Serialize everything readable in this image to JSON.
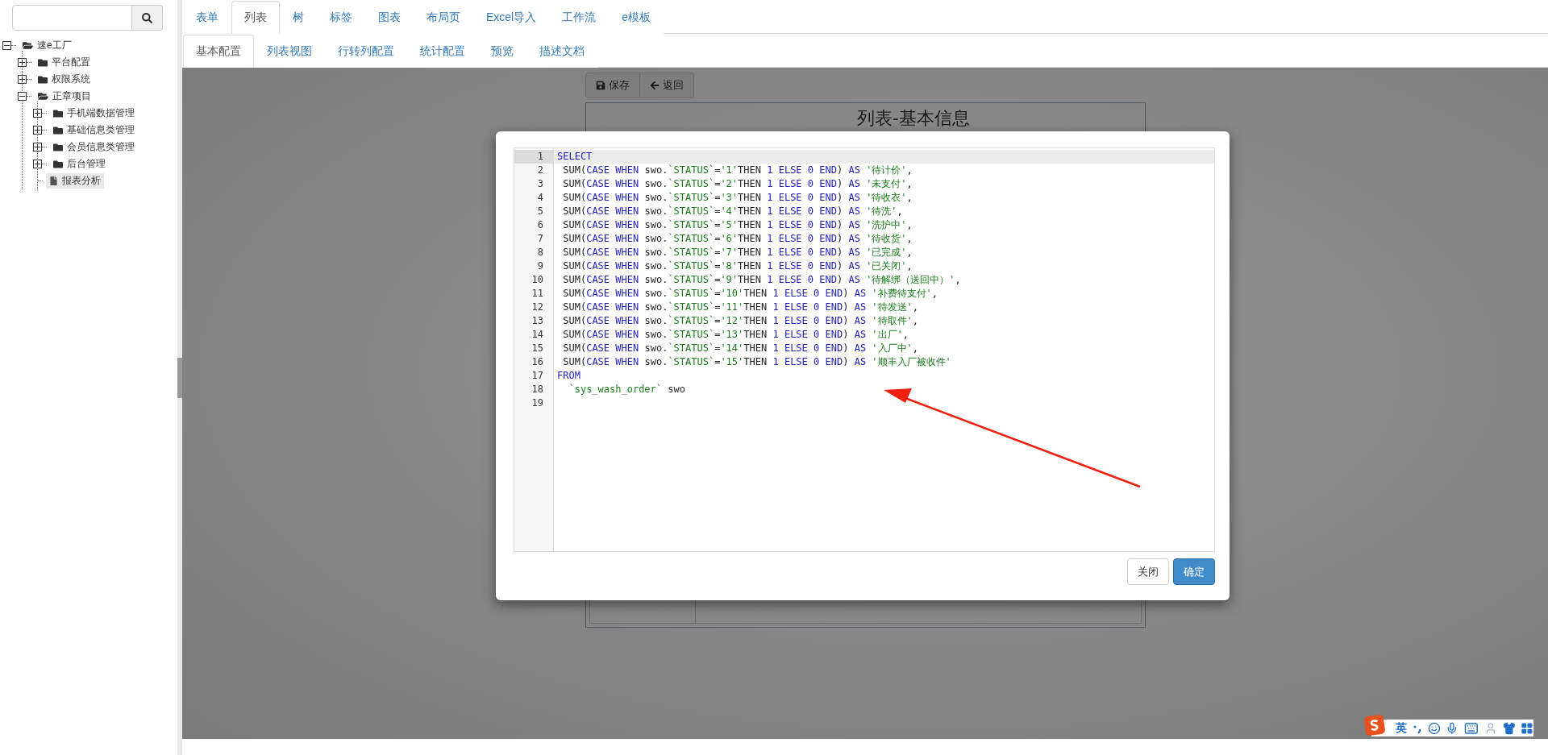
{
  "sidebar": {
    "tree": [
      {
        "label": "速e工厂",
        "kind": "folder",
        "expanded": true,
        "selected": false,
        "children": [
          {
            "label": "平台配置",
            "kind": "folder",
            "expanded": false,
            "selected": false
          },
          {
            "label": "权限系统",
            "kind": "folder",
            "expanded": false,
            "selected": false
          },
          {
            "label": "正章项目",
            "kind": "folder",
            "expanded": true,
            "selected": false,
            "children": [
              {
                "label": "手机端数据管理",
                "kind": "folder",
                "expanded": false,
                "selected": false
              },
              {
                "label": "基础信息类管理",
                "kind": "folder",
                "expanded": false,
                "selected": false
              },
              {
                "label": "会员信息类管理",
                "kind": "folder",
                "expanded": false,
                "selected": false
              },
              {
                "label": "后台管理",
                "kind": "folder",
                "expanded": false,
                "selected": false
              },
              {
                "label": "报表分析",
                "kind": "file",
                "selected": true
              }
            ]
          }
        ]
      }
    ]
  },
  "tabs": [
    {
      "label": "表单",
      "selected": false
    },
    {
      "label": "列表",
      "selected": true
    },
    {
      "label": "树",
      "selected": false
    },
    {
      "label": "标签",
      "selected": false
    },
    {
      "label": "图表",
      "selected": false
    },
    {
      "label": "布局页",
      "selected": false
    },
    {
      "label": "Excel导入",
      "selected": false
    },
    {
      "label": "工作流",
      "selected": false
    },
    {
      "label": "e模板",
      "selected": false
    }
  ],
  "subtabs": [
    {
      "label": "基本配置",
      "selected": true
    },
    {
      "label": "列表视图",
      "selected": false
    },
    {
      "label": "行转列配置",
      "selected": false
    },
    {
      "label": "统计配置",
      "selected": false
    },
    {
      "label": "预览",
      "selected": false
    },
    {
      "label": "描述文档",
      "selected": false
    }
  ],
  "background_form": {
    "buttons": [
      {
        "label": "保存",
        "kind": "save"
      },
      {
        "label": "返回",
        "kind": "back"
      }
    ],
    "title": "列表-基本信息"
  },
  "dialog": {
    "editor": {
      "lines": [
        {
          "number": "1",
          "text": "SELECT",
          "active": true
        },
        {
          "number": "2",
          "text": " SUM(CASE WHEN swo.`STATUS`='1'THEN 1 ELSE 0 END) AS '待计价',",
          "active": false
        },
        {
          "number": "3",
          "text": " SUM(CASE WHEN swo.`STATUS`='2'THEN 1 ELSE 0 END) AS '未支付',",
          "active": false
        },
        {
          "number": "4",
          "text": " SUM(CASE WHEN swo.`STATUS`='3'THEN 1 ELSE 0 END) AS '待收衣',",
          "active": false
        },
        {
          "number": "5",
          "text": " SUM(CASE WHEN swo.`STATUS`='4'THEN 1 ELSE 0 END) AS '待洗',",
          "active": false
        },
        {
          "number": "6",
          "text": " SUM(CASE WHEN swo.`STATUS`='5'THEN 1 ELSE 0 END) AS '洗护中',",
          "active": false
        },
        {
          "number": "7",
          "text": " SUM(CASE WHEN swo.`STATUS`='6'THEN 1 ELSE 0 END) AS '待收货',",
          "active": false
        },
        {
          "number": "8",
          "text": " SUM(CASE WHEN swo.`STATUS`='7'THEN 1 ELSE 0 END) AS '已完成',",
          "active": false
        },
        {
          "number": "9",
          "text": " SUM(CASE WHEN swo.`STATUS`='8'THEN 1 ELSE 0 END) AS '已关闭',",
          "active": false
        },
        {
          "number": "10",
          "text": " SUM(CASE WHEN swo.`STATUS`='9'THEN 1 ELSE 0 END) AS '待解绑（送回中）',",
          "active": false
        },
        {
          "number": "11",
          "text": " SUM(CASE WHEN swo.`STATUS`='10'THEN 1 ELSE 0 END) AS '补费待支付',",
          "active": false
        },
        {
          "number": "12",
          "text": " SUM(CASE WHEN swo.`STATUS`='11'THEN 1 ELSE 0 END) AS '待发送',",
          "active": false
        },
        {
          "number": "13",
          "text": " SUM(CASE WHEN swo.`STATUS`='12'THEN 1 ELSE 0 END) AS '待取件',",
          "active": false
        },
        {
          "number": "14",
          "text": " SUM(CASE WHEN swo.`STATUS`='13'THEN 1 ELSE 0 END) AS '出厂',",
          "active": false
        },
        {
          "number": "15",
          "text": " SUM(CASE WHEN swo.`STATUS`='14'THEN 1 ELSE 0 END) AS '入厂中',",
          "active": false
        },
        {
          "number": "16",
          "text": " SUM(CASE WHEN swo.`STATUS`='15'THEN 1 ELSE 0 END) AS '顺丰入厂被收件'",
          "active": false
        },
        {
          "number": "17",
          "text": "FROM",
          "active": false
        },
        {
          "number": "18",
          "text": "  `sys_wash_order` swo",
          "active": false
        },
        {
          "number": "19",
          "active": false
        }
      ]
    },
    "buttons": [
      {
        "label": "关闭",
        "kind": "default"
      },
      {
        "label": "确定",
        "kind": "primary"
      }
    ]
  },
  "ime_toolbar": {
    "mode": "英"
  }
}
